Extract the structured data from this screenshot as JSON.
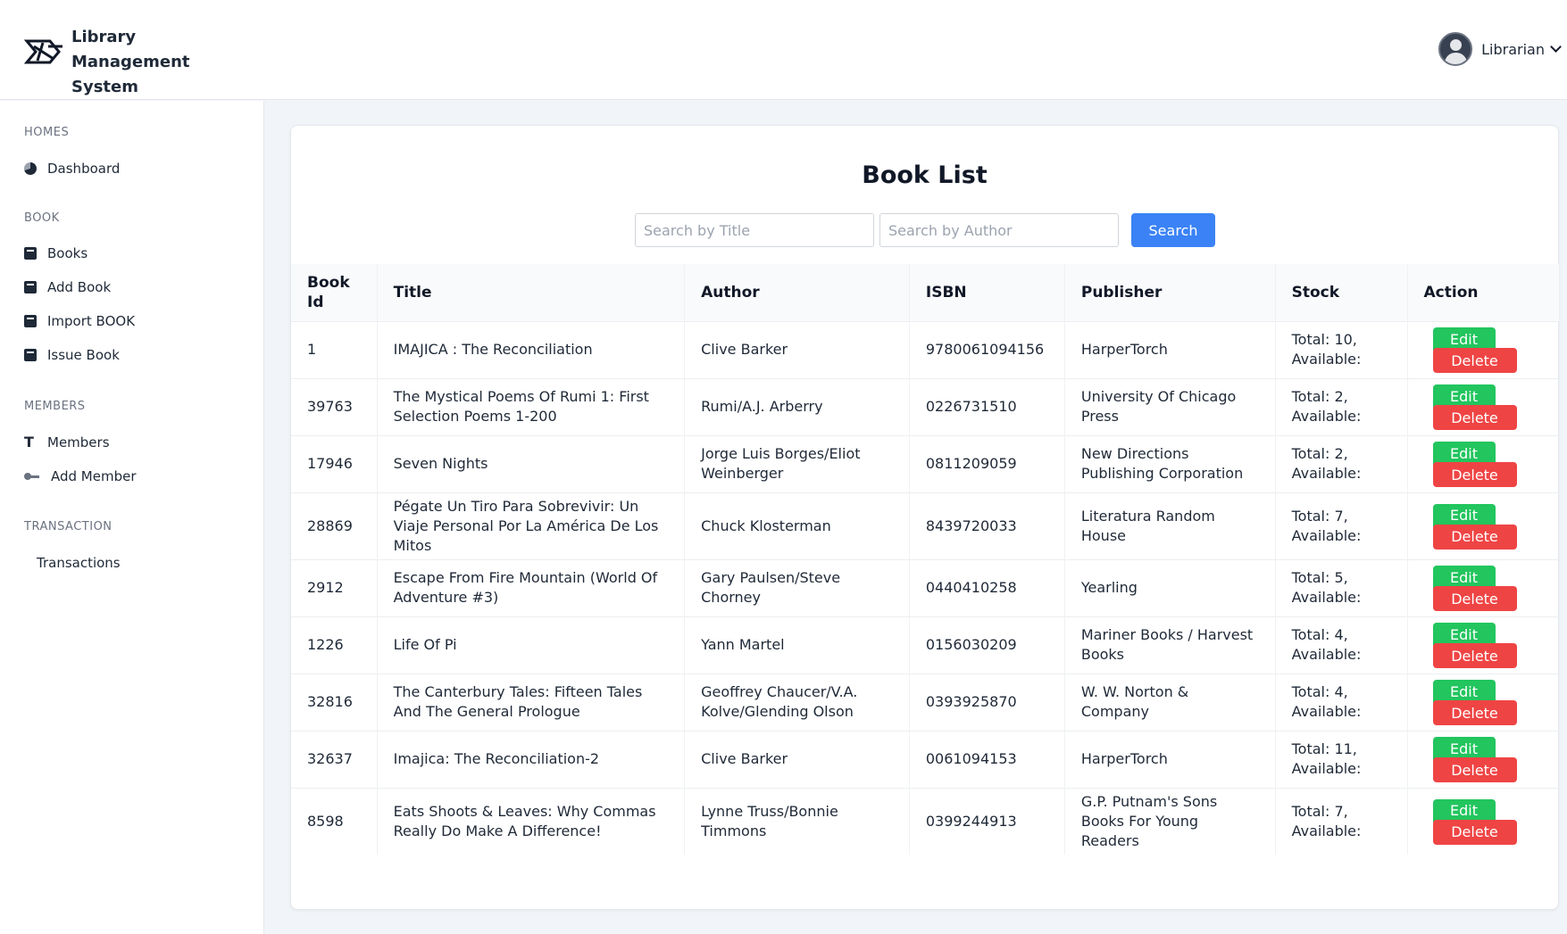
{
  "app": {
    "title": "Library Management System",
    "logo_icon": "library-logo-icon"
  },
  "user": {
    "name": "Librarian",
    "avatar_icon": "user-avatar-icon"
  },
  "sidebar": {
    "sections": [
      {
        "title": "HOMES",
        "items": [
          {
            "label": "Dashboard",
            "icon": "pie-chart-icon"
          }
        ]
      },
      {
        "title": "BOOK",
        "items": [
          {
            "label": "Books",
            "icon": "book-icon"
          },
          {
            "label": "Add Book",
            "icon": "book-icon"
          },
          {
            "label": "Import BOOK",
            "icon": "book-icon"
          },
          {
            "label": "Issue Book",
            "icon": "book-icon"
          }
        ]
      },
      {
        "title": "MEMBERS",
        "items": [
          {
            "label": "Members",
            "icon": "text-t-icon"
          },
          {
            "label": "Add Member",
            "icon": "key-icon"
          }
        ]
      },
      {
        "title": "TRANSACTION",
        "items": [
          {
            "label": "Transactions",
            "icon": ""
          }
        ]
      }
    ]
  },
  "main": {
    "title": "Book List",
    "search": {
      "title_placeholder": "Search by Title",
      "author_placeholder": "Search by Author",
      "button_label": "Search"
    },
    "table": {
      "headers": [
        "Book Id",
        "Title",
        "Author",
        "ISBN",
        "Publisher",
        "Stock",
        "Action"
      ],
      "edit_label": "Edit",
      "delete_label": "Delete",
      "rows": [
        {
          "id": "1",
          "title": "IMAJICA : The Reconciliation",
          "author": "Clive Barker",
          "isbn": "9780061094156",
          "publisher": "HarperTorch",
          "stock": "Total: 10, Available:"
        },
        {
          "id": "39763",
          "title": "The Mystical Poems Of Rumi 1: First Selection Poems 1-200",
          "author": "Rumi/A.J. Arberry",
          "isbn": "0226731510",
          "publisher": "University Of Chicago Press",
          "stock": "Total: 2, Available:"
        },
        {
          "id": "17946",
          "title": "Seven Nights",
          "author": "Jorge Luis Borges/Eliot Weinberger",
          "isbn": "0811209059",
          "publisher": "New Directions Publishing Corporation",
          "stock": "Total: 2, Available:"
        },
        {
          "id": "28869",
          "title": "Pégate Un Tiro Para Sobrevivir: Un Viaje Personal Por La América De Los Mitos",
          "author": "Chuck Klosterman",
          "isbn": "8439720033",
          "publisher": "Literatura Random House",
          "stock": "Total: 7, Available:"
        },
        {
          "id": "2912",
          "title": "Escape From Fire Mountain (World Of Adventure #3)",
          "author": "Gary Paulsen/Steve Chorney",
          "isbn": "0440410258",
          "publisher": "Yearling",
          "stock": "Total: 5, Available:"
        },
        {
          "id": "1226",
          "title": "Life Of Pi",
          "author": "Yann Martel",
          "isbn": "0156030209",
          "publisher": "Mariner Books / Harvest Books",
          "stock": "Total: 4, Available:"
        },
        {
          "id": "32816",
          "title": "The Canterbury Tales: Fifteen Tales And The General Prologue",
          "author": "Geoffrey Chaucer/V.A. Kolve/Glending Olson",
          "isbn": "0393925870",
          "publisher": "W. W. Norton & Company",
          "stock": "Total: 4, Available:"
        },
        {
          "id": "32637",
          "title": "Imajica: The Reconciliation-2",
          "author": "Clive Barker",
          "isbn": "0061094153",
          "publisher": "HarperTorch",
          "stock": "Total: 11, Available:"
        },
        {
          "id": "8598",
          "title": "Eats Shoots & Leaves: Why Commas Really Do Make A Difference!",
          "author": "Lynne Truss/Bonnie Timmons",
          "isbn": "0399244913",
          "publisher": "G.P. Putnam's Sons Books For Young Readers",
          "stock": "Total: 7, Available:"
        }
      ]
    }
  },
  "colors": {
    "accent": "#3b82f6",
    "edit": "#22c55e",
    "delete": "#ef4444",
    "background": "#f1f5f9"
  }
}
